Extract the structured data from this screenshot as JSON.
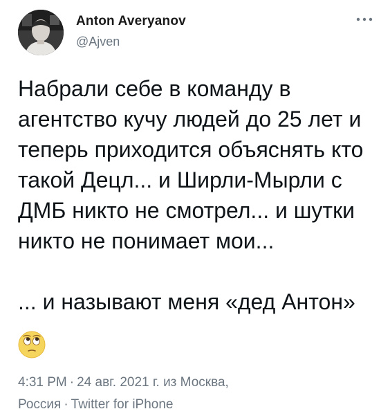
{
  "author": {
    "name": "Anton Averyanov",
    "handle": "@Ajven",
    "avatar_icon": "user-avatar-photo"
  },
  "menu": {
    "more_icon": "more-horizontal-icon"
  },
  "tweet": {
    "text_part1": "Набрали себе в команду в агентство кучу людей до 25 лет и теперь приходится объяснять кто такой Децл... и Ширли-Мырли с ДМБ никто не смотрел... и шутки никто не понимает мои...",
    "text_part2": "... и называют меня «дед Антон»",
    "emoji": "face-with-rolling-eyes-emoji"
  },
  "meta": {
    "time": "4:31 PM",
    "date": "24 авг. 2021 г.",
    "from_label": "из",
    "location_line1": "Москва,",
    "location_line2": "Россия",
    "source": "Twitter for iPhone",
    "separator": "·"
  },
  "colors": {
    "text": "#0f1419",
    "secondary": "#6b7680",
    "background": "#ffffff"
  }
}
